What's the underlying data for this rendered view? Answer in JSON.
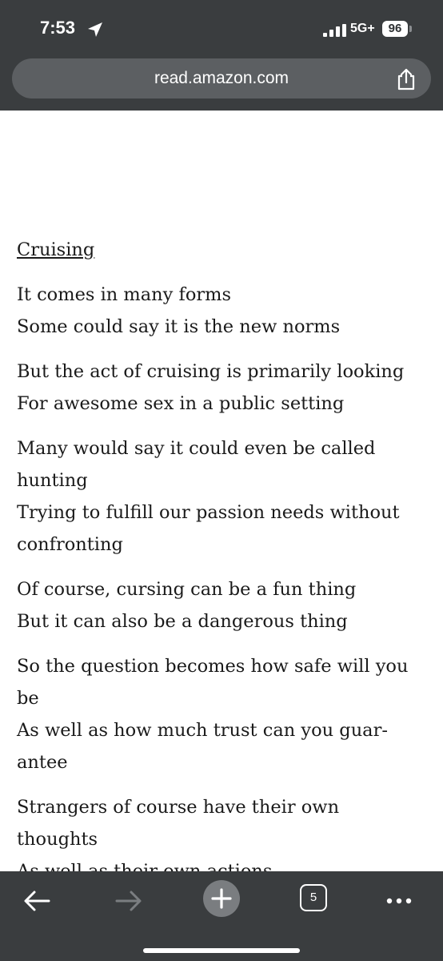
{
  "status_bar": {
    "time": "7:53",
    "network": "5G+",
    "battery": "96"
  },
  "browser": {
    "url": "read.amazon.com"
  },
  "book": {
    "title": "Cruising",
    "stanzas": [
      [
        "It comes in many forms",
        "Some could say it is the new norms"
      ],
      [
        "But the act of cruising is primarily looking",
        "For awesome sex in a public setting"
      ],
      [
        "Many would say it could even be called",
        "hunting",
        "Trying to fulfill our passion needs without",
        "confronting"
      ],
      [
        "Of course, cursing can be a fun thing",
        "But it can also be a dangerous thing"
      ],
      [
        "So the question becomes how safe will you",
        "be",
        "As well as how much trust can you guar-",
        "antee"
      ],
      [
        "Strangers of course have their own",
        "thoughts",
        "As well as their own actions"
      ]
    ]
  },
  "toolbar": {
    "tab_count": "5"
  },
  "icons": {
    "location": "location-arrow-icon",
    "share": "share-icon",
    "back": "back-arrow-icon",
    "forward": "forward-arrow-icon",
    "new_tab": "plus-icon",
    "tabs": "tabs-icon",
    "more": "more-icon"
  },
  "colors": {
    "chrome_bg": "#3a3d3f",
    "url_bar": "#5c5f62",
    "text": "#1a1a1a"
  }
}
